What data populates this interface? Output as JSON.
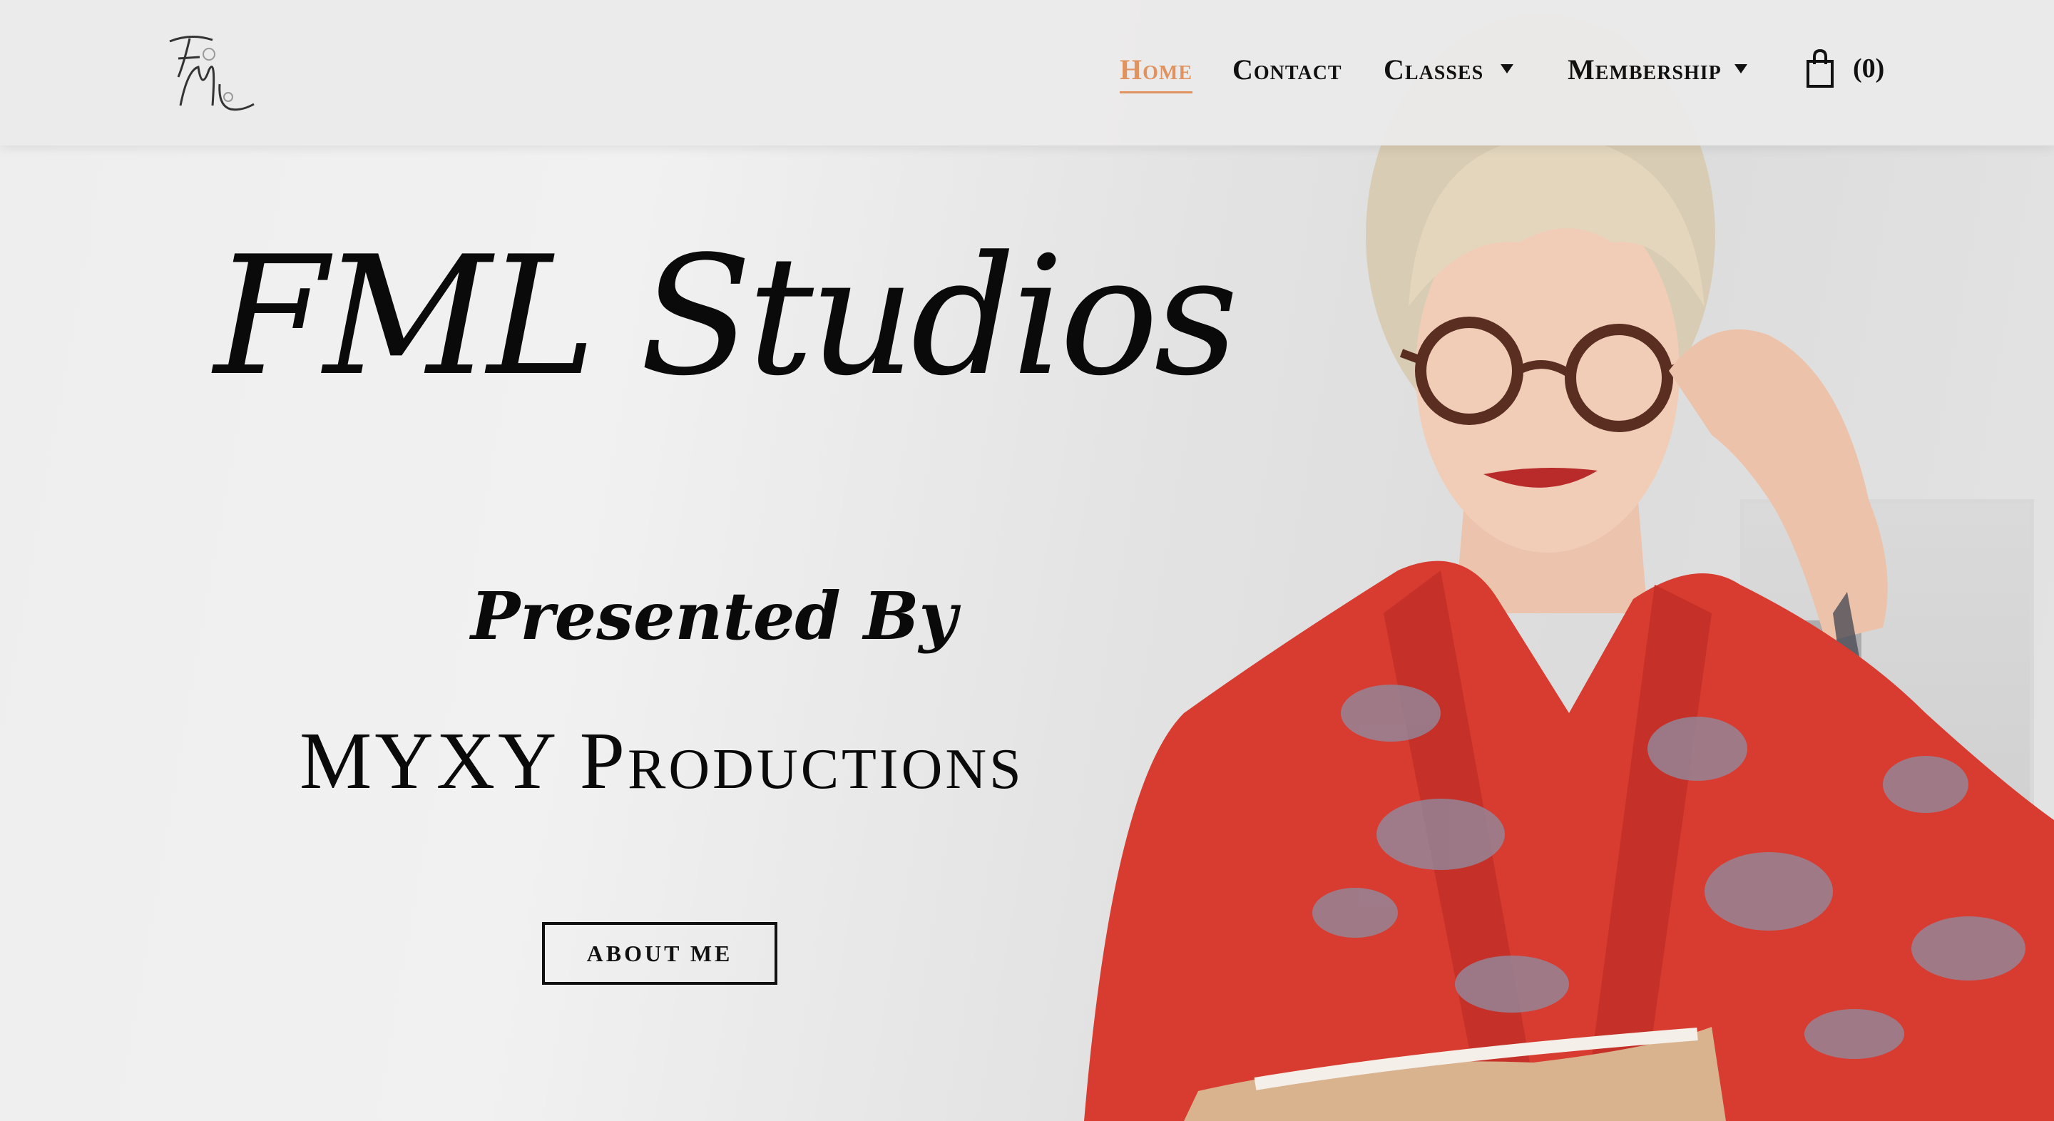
{
  "header": {
    "logo_alt": "FML",
    "nav": [
      {
        "label": "Home",
        "active": true
      },
      {
        "label": "Contact",
        "active": false
      },
      {
        "label": "Classes",
        "active": false,
        "has_dropdown": true
      },
      {
        "label": "Membership",
        "active": false,
        "has_dropdown": true
      }
    ],
    "cart_count": "(0)",
    "accent_color": "#e0935f"
  },
  "hero": {
    "title": "FML Studios",
    "subtitle": "Presented By",
    "company": "MYXY Productions",
    "cta_label": "ABOUT ME"
  },
  "icons": {
    "logo": "fml-monogram-logo",
    "cart": "shopping-bag-icon",
    "dropdown": "caret-down-icon"
  }
}
